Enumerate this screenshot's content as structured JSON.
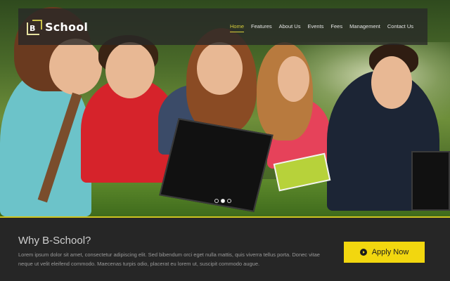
{
  "brand": {
    "mark_letter": "B",
    "name": "School"
  },
  "nav": {
    "items": [
      {
        "label": "Home",
        "active": true
      },
      {
        "label": "Features",
        "active": false
      },
      {
        "label": "About Us",
        "active": false
      },
      {
        "label": "Events",
        "active": false
      },
      {
        "label": "Fees",
        "active": false
      },
      {
        "label": "Management",
        "active": false
      },
      {
        "label": "Contact Us",
        "active": false
      }
    ]
  },
  "slider": {
    "slide_count": 3,
    "active_index": 1
  },
  "why": {
    "title": "Why B-School?",
    "body": "Lorem ipsum dolor sit amet, consectetur adipiscing elit. Sed bibendum orci eget nulla mattis, quis viverra tellus porta. Donec vitae neque ut velit eleifend commodo. Maecenas turpis odio, placerat eu lorem ut, suscipit commodo augue."
  },
  "cta": {
    "label": "Apply Now",
    "icon": "play-circle-icon"
  },
  "colors": {
    "accent": "#f2d70f",
    "nav_active": "#d8cf3a",
    "footer_bg": "#262626"
  }
}
